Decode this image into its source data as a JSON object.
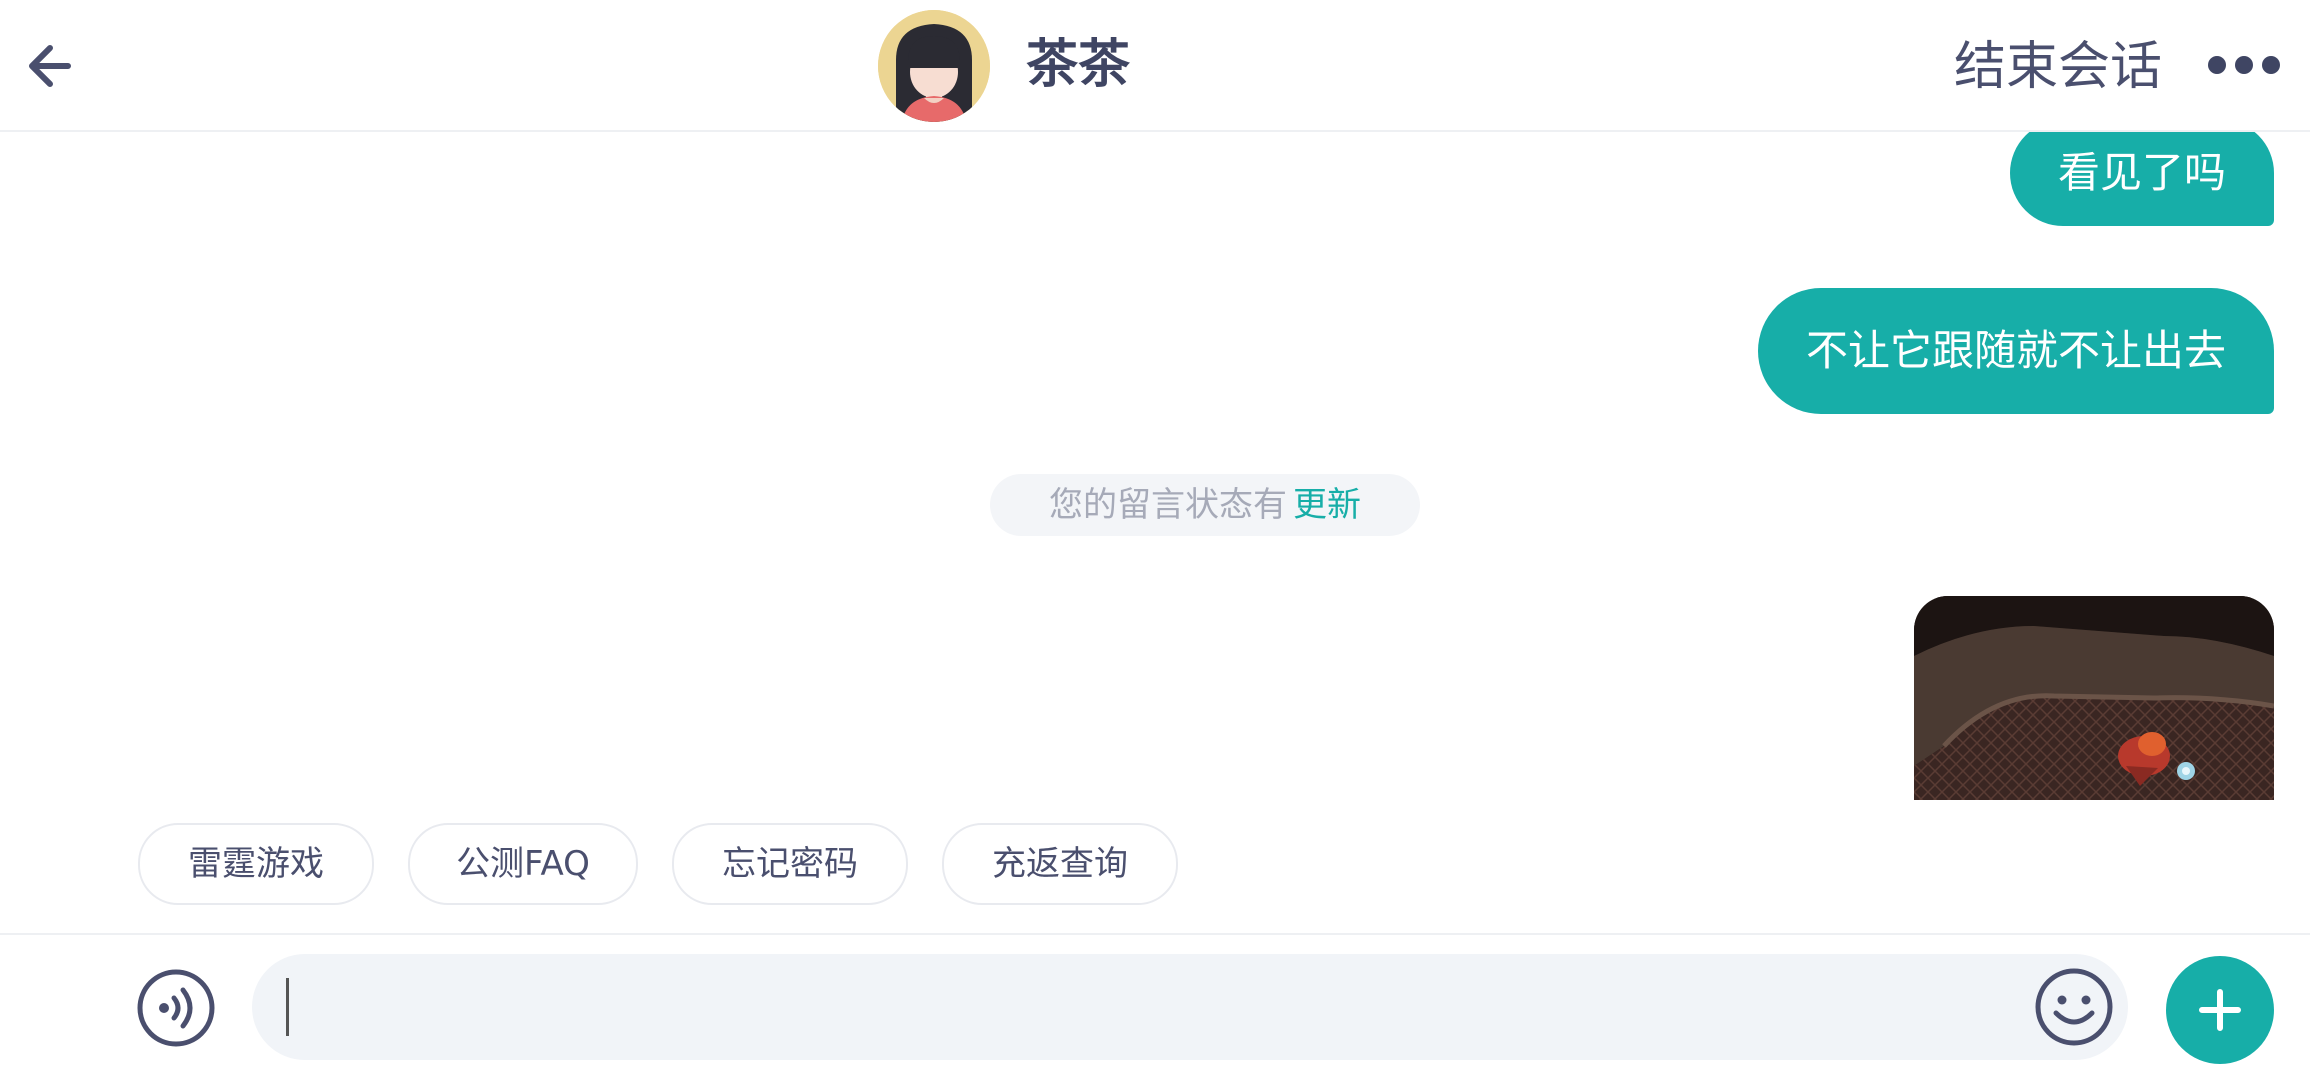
{
  "header": {
    "contact_name": "茶茶",
    "end_session_label": "结束会话"
  },
  "messages": [
    {
      "type": "outgoing-text",
      "text": "看见了吗"
    },
    {
      "type": "outgoing-text",
      "text": "不让它跟随就不让出去"
    },
    {
      "type": "system-notice",
      "text": "您的留言状态有",
      "link": "更新"
    },
    {
      "type": "outgoing-image"
    }
  ],
  "quick_replies": [
    "雷霆游戏",
    "公测FAQ",
    "忘记密码",
    "充返查询"
  ],
  "input": {
    "placeholder": ""
  },
  "colors": {
    "accent": "#17aea8",
    "text_dark": "#3f4563",
    "text_muted": "#a6aab8",
    "input_bg": "#f1f4f8",
    "avatar_bg": "#ecd592"
  },
  "icons": {
    "back": "arrow-left-icon",
    "more": "more-dots-icon",
    "voice": "voice-icon",
    "emoji": "emoji-icon",
    "plus": "plus-icon"
  }
}
